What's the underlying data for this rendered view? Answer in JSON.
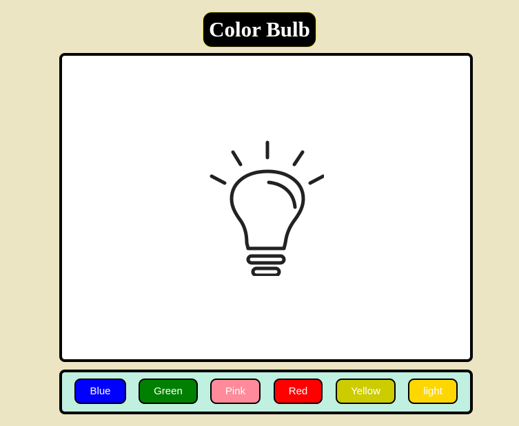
{
  "title": "Color Bulb",
  "buttons": [
    {
      "key": "blue",
      "label": "Blue",
      "color": "#0000ff"
    },
    {
      "key": "green",
      "label": "Green",
      "color": "#008000"
    },
    {
      "key": "pink",
      "label": "Pink",
      "color": "#ff8a9a"
    },
    {
      "key": "red",
      "label": "Red",
      "color": "#ff0000"
    },
    {
      "key": "yellow",
      "label": "Yellow",
      "color": "#cccc00"
    },
    {
      "key": "light",
      "label": "light",
      "color": "#ffd700"
    }
  ],
  "bulb_icon": "lightbulb-icon",
  "colors": {
    "page_background": "#ece5c4",
    "stage_background": "#ffffff",
    "controls_background": "#c0f0df",
    "title_background": "#000000",
    "title_outline": "#e7e23a",
    "bulb_stroke": "#222222"
  }
}
